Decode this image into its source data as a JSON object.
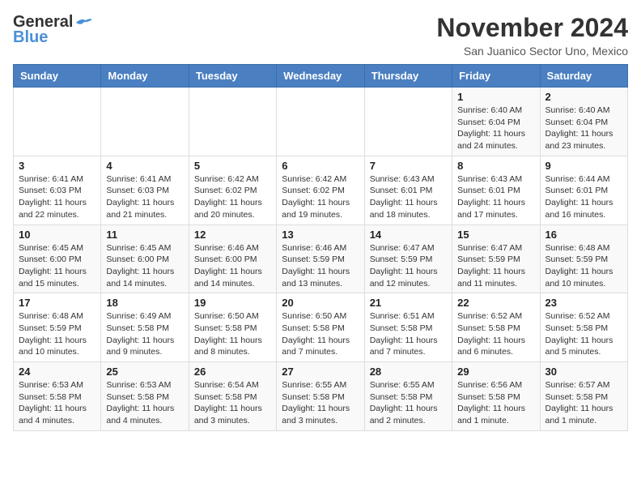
{
  "header": {
    "logo_general": "General",
    "logo_blue": "Blue",
    "month": "November 2024",
    "location": "San Juanico Sector Uno, Mexico"
  },
  "weekdays": [
    "Sunday",
    "Monday",
    "Tuesday",
    "Wednesday",
    "Thursday",
    "Friday",
    "Saturday"
  ],
  "weeks": [
    [
      {
        "day": "",
        "detail": ""
      },
      {
        "day": "",
        "detail": ""
      },
      {
        "day": "",
        "detail": ""
      },
      {
        "day": "",
        "detail": ""
      },
      {
        "day": "",
        "detail": ""
      },
      {
        "day": "1",
        "detail": "Sunrise: 6:40 AM\nSunset: 6:04 PM\nDaylight: 11 hours\nand 24 minutes."
      },
      {
        "day": "2",
        "detail": "Sunrise: 6:40 AM\nSunset: 6:04 PM\nDaylight: 11 hours\nand 23 minutes."
      }
    ],
    [
      {
        "day": "3",
        "detail": "Sunrise: 6:41 AM\nSunset: 6:03 PM\nDaylight: 11 hours\nand 22 minutes."
      },
      {
        "day": "4",
        "detail": "Sunrise: 6:41 AM\nSunset: 6:03 PM\nDaylight: 11 hours\nand 21 minutes."
      },
      {
        "day": "5",
        "detail": "Sunrise: 6:42 AM\nSunset: 6:02 PM\nDaylight: 11 hours\nand 20 minutes."
      },
      {
        "day": "6",
        "detail": "Sunrise: 6:42 AM\nSunset: 6:02 PM\nDaylight: 11 hours\nand 19 minutes."
      },
      {
        "day": "7",
        "detail": "Sunrise: 6:43 AM\nSunset: 6:01 PM\nDaylight: 11 hours\nand 18 minutes."
      },
      {
        "day": "8",
        "detail": "Sunrise: 6:43 AM\nSunset: 6:01 PM\nDaylight: 11 hours\nand 17 minutes."
      },
      {
        "day": "9",
        "detail": "Sunrise: 6:44 AM\nSunset: 6:01 PM\nDaylight: 11 hours\nand 16 minutes."
      }
    ],
    [
      {
        "day": "10",
        "detail": "Sunrise: 6:45 AM\nSunset: 6:00 PM\nDaylight: 11 hours\nand 15 minutes."
      },
      {
        "day": "11",
        "detail": "Sunrise: 6:45 AM\nSunset: 6:00 PM\nDaylight: 11 hours\nand 14 minutes."
      },
      {
        "day": "12",
        "detail": "Sunrise: 6:46 AM\nSunset: 6:00 PM\nDaylight: 11 hours\nand 14 minutes."
      },
      {
        "day": "13",
        "detail": "Sunrise: 6:46 AM\nSunset: 5:59 PM\nDaylight: 11 hours\nand 13 minutes."
      },
      {
        "day": "14",
        "detail": "Sunrise: 6:47 AM\nSunset: 5:59 PM\nDaylight: 11 hours\nand 12 minutes."
      },
      {
        "day": "15",
        "detail": "Sunrise: 6:47 AM\nSunset: 5:59 PM\nDaylight: 11 hours\nand 11 minutes."
      },
      {
        "day": "16",
        "detail": "Sunrise: 6:48 AM\nSunset: 5:59 PM\nDaylight: 11 hours\nand 10 minutes."
      }
    ],
    [
      {
        "day": "17",
        "detail": "Sunrise: 6:48 AM\nSunset: 5:59 PM\nDaylight: 11 hours\nand 10 minutes."
      },
      {
        "day": "18",
        "detail": "Sunrise: 6:49 AM\nSunset: 5:58 PM\nDaylight: 11 hours\nand 9 minutes."
      },
      {
        "day": "19",
        "detail": "Sunrise: 6:50 AM\nSunset: 5:58 PM\nDaylight: 11 hours\nand 8 minutes."
      },
      {
        "day": "20",
        "detail": "Sunrise: 6:50 AM\nSunset: 5:58 PM\nDaylight: 11 hours\nand 7 minutes."
      },
      {
        "day": "21",
        "detail": "Sunrise: 6:51 AM\nSunset: 5:58 PM\nDaylight: 11 hours\nand 7 minutes."
      },
      {
        "day": "22",
        "detail": "Sunrise: 6:52 AM\nSunset: 5:58 PM\nDaylight: 11 hours\nand 6 minutes."
      },
      {
        "day": "23",
        "detail": "Sunrise: 6:52 AM\nSunset: 5:58 PM\nDaylight: 11 hours\nand 5 minutes."
      }
    ],
    [
      {
        "day": "24",
        "detail": "Sunrise: 6:53 AM\nSunset: 5:58 PM\nDaylight: 11 hours\nand 4 minutes."
      },
      {
        "day": "25",
        "detail": "Sunrise: 6:53 AM\nSunset: 5:58 PM\nDaylight: 11 hours\nand 4 minutes."
      },
      {
        "day": "26",
        "detail": "Sunrise: 6:54 AM\nSunset: 5:58 PM\nDaylight: 11 hours\nand 3 minutes."
      },
      {
        "day": "27",
        "detail": "Sunrise: 6:55 AM\nSunset: 5:58 PM\nDaylight: 11 hours\nand 3 minutes."
      },
      {
        "day": "28",
        "detail": "Sunrise: 6:55 AM\nSunset: 5:58 PM\nDaylight: 11 hours\nand 2 minutes."
      },
      {
        "day": "29",
        "detail": "Sunrise: 6:56 AM\nSunset: 5:58 PM\nDaylight: 11 hours\nand 1 minute."
      },
      {
        "day": "30",
        "detail": "Sunrise: 6:57 AM\nSunset: 5:58 PM\nDaylight: 11 hours\nand 1 minute."
      }
    ]
  ]
}
